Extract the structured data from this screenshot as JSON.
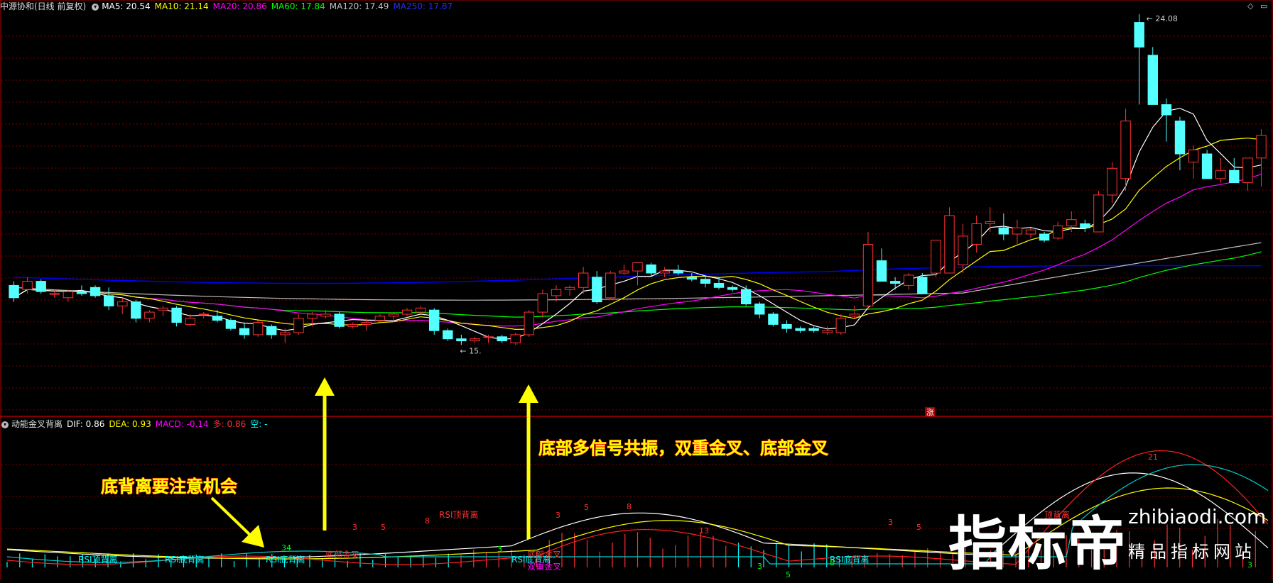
{
  "top_panel": {
    "title": "中源协和(日线 前复权)",
    "ma": [
      {
        "label": "MA5: 20.54",
        "color": "#ffffff"
      },
      {
        "label": "MA10: 21.14",
        "color": "#ffff00"
      },
      {
        "label": "MA20: 20.86",
        "color": "#ff00ff"
      },
      {
        "label": "MA60: 17.84",
        "color": "#00ff00"
      },
      {
        "label": "MA120: 17.49",
        "color": "#c0c0c0"
      },
      {
        "label": "MA250: 17.87",
        "color": "#0000ff"
      }
    ],
    "high_label": "24.08",
    "low_label": "15.",
    "marker": "涨"
  },
  "bottom_panel": {
    "title": "动能金叉背离",
    "stats": [
      {
        "label": "DIF: 0.86",
        "color": "#ffffff"
      },
      {
        "label": "DEA: 0.93",
        "color": "#ffff00"
      },
      {
        "label": "MACD: -0.14",
        "color": "#ff00ff"
      },
      {
        "label": "多: 0.86",
        "color": "#ff3030"
      },
      {
        "label": "空: -",
        "color": "#00ffff"
      }
    ]
  },
  "annotations": {
    "left": "底背离要注意机会",
    "mid": "底部多信号共振，双重金叉、底部金叉"
  },
  "signals": [
    {
      "text": "RSI顶背离",
      "color": "#00ffff"
    },
    {
      "text": "RSI底背离",
      "color": "#00ffff"
    },
    {
      "text": "RSI底背离",
      "color": "#00ffff"
    },
    {
      "text": "底部金叉",
      "color": "#ff3030"
    },
    {
      "text": "RSI顶背离",
      "color": "#ff3030"
    },
    {
      "text": "RSI底背离",
      "color": "#00ffff"
    },
    {
      "text": "底部金叉",
      "color": "#ff3030"
    },
    {
      "text": "双重金叉",
      "color": "#ff00ff"
    },
    {
      "text": "RSI底背离",
      "color": "#00ffff"
    },
    {
      "text": "顶背离",
      "color": "#ff3030"
    }
  ],
  "counts": [
    {
      "text": "34",
      "color": "#00ff00"
    },
    {
      "text": "3",
      "color": "#ff3030"
    },
    {
      "text": "5",
      "color": "#ff3030"
    },
    {
      "text": "8",
      "color": "#ff3030"
    },
    {
      "text": "3",
      "color": "#00ff00"
    },
    {
      "text": "3",
      "color": "#ff3030"
    },
    {
      "text": "5",
      "color": "#ff3030"
    },
    {
      "text": "8",
      "color": "#ff3030"
    },
    {
      "text": "13",
      "color": "#ff3030"
    },
    {
      "text": "3",
      "color": "#00ff00"
    },
    {
      "text": "5",
      "color": "#00ff00"
    },
    {
      "text": "8",
      "color": "#00ff00"
    },
    {
      "text": "3",
      "color": "#ff3030"
    },
    {
      "text": "5",
      "color": "#ff3030"
    },
    {
      "text": "21",
      "color": "#ff3030"
    },
    {
      "text": "3",
      "color": "#00ff00"
    }
  ],
  "watermark": {
    "brand": "指标帝",
    "domain": "zhibiaodi.com",
    "slogan": "精品指标网站"
  },
  "chart_data": {
    "type": "candlestick",
    "ylim": [
      14.9,
      24.6
    ],
    "candles": [
      [
        18.0,
        18.1,
        17.6,
        17.7
      ],
      [
        17.9,
        18.2,
        17.8,
        18.1
      ],
      [
        18.1,
        18.15,
        17.8,
        17.85
      ],
      [
        17.8,
        17.9,
        17.7,
        17.8
      ],
      [
        17.7,
        17.9,
        17.6,
        17.85
      ],
      [
        17.85,
        18.0,
        17.75,
        17.8
      ],
      [
        17.95,
        18.0,
        17.7,
        17.75
      ],
      [
        17.75,
        17.95,
        17.4,
        17.5
      ],
      [
        17.5,
        17.7,
        17.3,
        17.6
      ],
      [
        17.6,
        17.65,
        17.1,
        17.2
      ],
      [
        17.2,
        17.4,
        17.1,
        17.35
      ],
      [
        17.4,
        17.5,
        17.25,
        17.45
      ],
      [
        17.45,
        17.5,
        17.0,
        17.1
      ],
      [
        17.05,
        17.3,
        17.0,
        17.2
      ],
      [
        17.3,
        17.35,
        17.2,
        17.3
      ],
      [
        17.25,
        17.4,
        17.1,
        17.15
      ],
      [
        17.15,
        17.2,
        16.9,
        16.95
      ],
      [
        16.95,
        17.1,
        16.7,
        16.8
      ],
      [
        16.8,
        17.15,
        16.75,
        17.1
      ],
      [
        17.0,
        17.05,
        16.7,
        16.8
      ],
      [
        16.8,
        16.95,
        16.6,
        16.85
      ],
      [
        16.85,
        17.3,
        16.8,
        17.2
      ],
      [
        17.2,
        17.35,
        17.0,
        17.3
      ],
      [
        17.25,
        17.4,
        17.2,
        17.3
      ],
      [
        17.3,
        17.35,
        16.95,
        17.0
      ],
      [
        17.0,
        17.1,
        16.95,
        17.05
      ],
      [
        17.05,
        17.2,
        16.9,
        17.1
      ],
      [
        17.15,
        17.3,
        17.1,
        17.25
      ],
      [
        17.25,
        17.35,
        17.1,
        17.3
      ],
      [
        17.3,
        17.45,
        17.25,
        17.4
      ],
      [
        17.35,
        17.5,
        17.3,
        17.45
      ],
      [
        17.4,
        17.45,
        16.8,
        16.9
      ],
      [
        16.9,
        16.95,
        16.65,
        16.7
      ],
      [
        16.7,
        16.8,
        16.55,
        16.65
      ],
      [
        16.65,
        16.75,
        16.6,
        16.7
      ],
      [
        16.75,
        16.8,
        16.6,
        16.75
      ],
      [
        16.75,
        16.8,
        16.6,
        16.65
      ],
      [
        16.6,
        16.85,
        16.55,
        16.8
      ],
      [
        16.8,
        17.4,
        16.75,
        17.35
      ],
      [
        17.35,
        17.9,
        17.2,
        17.8
      ],
      [
        17.75,
        18.0,
        17.6,
        17.9
      ],
      [
        17.9,
        18.0,
        17.75,
        17.95
      ],
      [
        17.95,
        18.45,
        17.8,
        18.3
      ],
      [
        18.2,
        18.35,
        17.55,
        17.6
      ],
      [
        17.7,
        18.35,
        17.65,
        18.3
      ],
      [
        18.3,
        18.5,
        18.25,
        18.35
      ],
      [
        18.35,
        18.5,
        18.0,
        18.55
      ],
      [
        18.5,
        18.55,
        18.2,
        18.3
      ],
      [
        18.3,
        18.45,
        18.2,
        18.35
      ],
      [
        18.35,
        18.5,
        18.25,
        18.3
      ],
      [
        18.2,
        18.3,
        18.1,
        18.15
      ],
      [
        18.15,
        18.25,
        17.95,
        18.05
      ],
      [
        18.05,
        18.2,
        17.9,
        17.95
      ],
      [
        17.95,
        18.0,
        17.85,
        17.9
      ],
      [
        17.9,
        18.0,
        17.5,
        17.55
      ],
      [
        17.55,
        17.6,
        17.2,
        17.3
      ],
      [
        17.3,
        17.35,
        17.0,
        17.05
      ],
      [
        17.05,
        17.15,
        16.85,
        16.95
      ],
      [
        16.95,
        17.0,
        16.85,
        16.9
      ],
      [
        16.95,
        17.0,
        16.85,
        16.9
      ],
      [
        16.85,
        17.0,
        16.8,
        16.9
      ],
      [
        16.85,
        17.3,
        16.8,
        17.2
      ],
      [
        17.25,
        17.5,
        17.2,
        17.3
      ],
      [
        17.5,
        19.3,
        17.4,
        19.0
      ],
      [
        18.6,
        18.9,
        18.1,
        18.1
      ],
      [
        18.1,
        18.2,
        17.9,
        18.05
      ],
      [
        18.0,
        18.3,
        17.9,
        18.25
      ],
      [
        18.2,
        18.3,
        17.8,
        17.8
      ],
      [
        18.3,
        19.1,
        18.2,
        19.1
      ],
      [
        18.3,
        19.9,
        18.3,
        19.7
      ],
      [
        18.5,
        19.5,
        18.3,
        19.2
      ],
      [
        19.0,
        19.7,
        18.8,
        19.5
      ],
      [
        19.5,
        19.9,
        19.3,
        19.55
      ],
      [
        19.4,
        19.75,
        19.1,
        19.25
      ],
      [
        19.25,
        19.6,
        19.0,
        19.4
      ],
      [
        19.25,
        19.4,
        19.15,
        19.35
      ],
      [
        19.25,
        19.3,
        19.05,
        19.1
      ],
      [
        19.15,
        19.55,
        19.1,
        19.45
      ],
      [
        19.45,
        19.8,
        19.3,
        19.6
      ],
      [
        19.5,
        19.6,
        19.3,
        19.4
      ],
      [
        19.3,
        20.3,
        19.3,
        20.2
      ],
      [
        20.2,
        21.0,
        20.0,
        20.85
      ],
      [
        20.6,
        22.3,
        20.3,
        22.0
      ],
      [
        24.4,
        24.6,
        22.4,
        23.8
      ],
      [
        23.6,
        23.8,
        22.5,
        22.4
      ],
      [
        22.4,
        22.55,
        21.5,
        22.15
      ],
      [
        22.0,
        22.1,
        20.8,
        21.2
      ],
      [
        21.0,
        21.4,
        20.6,
        21.3
      ],
      [
        21.2,
        21.3,
        20.6,
        20.6
      ],
      [
        20.6,
        21.1,
        20.5,
        20.8
      ],
      [
        20.8,
        21.1,
        20.5,
        20.5
      ],
      [
        20.5,
        21.1,
        20.3,
        21.1
      ],
      [
        21.1,
        21.8,
        20.4,
        21.65
      ]
    ]
  }
}
